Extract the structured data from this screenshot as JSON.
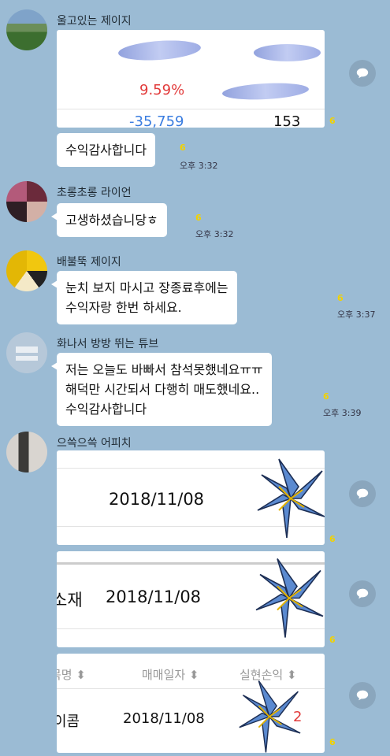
{
  "colors": {
    "background": "#9bbbd4",
    "bubble": "#ffffff",
    "unread": "#f2d200",
    "share_button": "#8aa6bd",
    "red": "#e23b3b",
    "blue": "#3a7de0"
  },
  "messages": [
    {
      "sender": "울고있는 제이지",
      "image": {
        "value_red": "9.59%",
        "value_blue": "-35,759",
        "value_black": "153"
      },
      "unread": "6"
    },
    {
      "text": "수익감사합니다",
      "unread": "6",
      "time": "오후 3:32"
    },
    {
      "sender": "초롱초롱 라이언",
      "text": "고생하셨습니당ㅎ",
      "unread": "6",
      "time": "오후 3:32"
    },
    {
      "sender": "배불뚝 제이지",
      "text": "눈치 보지 마시고 장종료후에는\n수익자랑 한번 하세요.",
      "unread": "6",
      "time": "오후 3:37"
    },
    {
      "sender": "화나서 방방 뛰는 튜브",
      "text": "저는 오늘도 바빠서 참석못했네요ㅠㅠ\n해덕만 시간되서 다행히 매도했네요..\n수익감사합니다",
      "unread": "6",
      "time": "오후 3:39"
    },
    {
      "sender": "으쓱으쓱 어피치",
      "image": {
        "date": "2018/11/08"
      },
      "unread": "6"
    },
    {
      "image": {
        "left_text": "소재",
        "date": "2018/11/08"
      },
      "unread": "6"
    },
    {
      "image": {
        "headers": [
          "목명 ⬍",
          "매매일자 ⬍",
          "실현손익 ⬍"
        ],
        "left_text": "이콤",
        "date": "2018/11/08",
        "right_text": "2"
      },
      "unread": "6"
    }
  ],
  "icons": {
    "share": "chat-bubble-icon",
    "flower": "lily-sticker"
  }
}
